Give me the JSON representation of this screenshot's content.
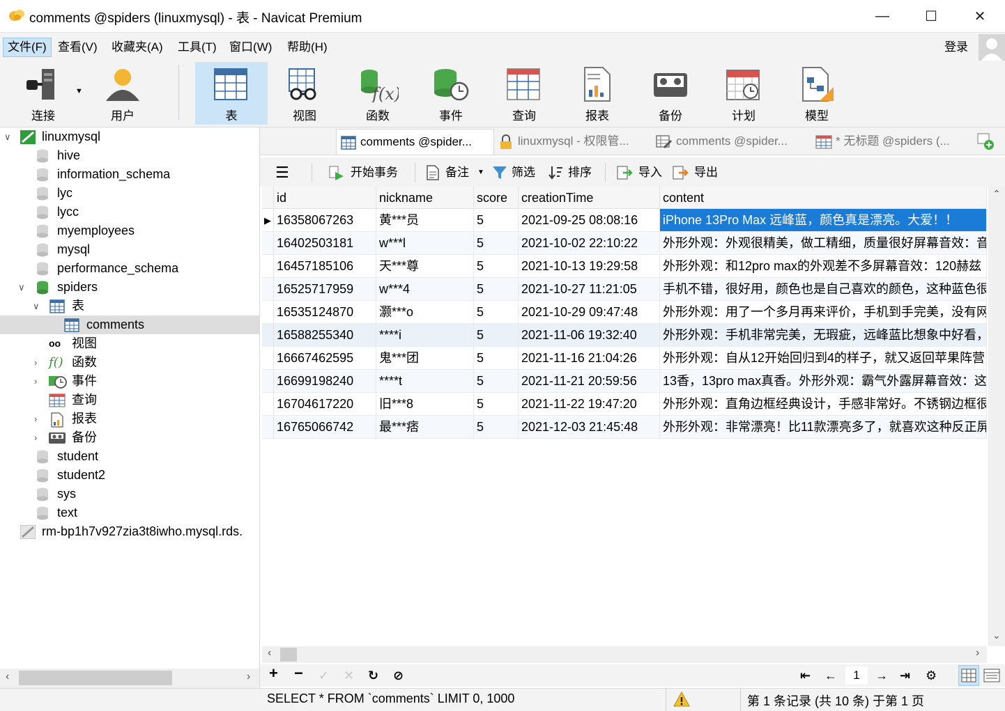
{
  "window": {
    "title": "comments @spiders (linuxmysql) - 表 - Navicat Premium",
    "minimize": "—",
    "maximize": "☐",
    "close": "✕"
  },
  "menu": {
    "items": [
      "文件(F)",
      "查看(V)",
      "收藏夹(A)",
      "工具(T)",
      "窗口(W)",
      "帮助(H)"
    ],
    "login": "登录"
  },
  "toolbar": {
    "connect": "连接",
    "user": "用户",
    "table": "表",
    "view": "视图",
    "function": "函数",
    "event": "事件",
    "query": "查询",
    "report": "报表",
    "backup": "备份",
    "schedule": "计划",
    "model": "模型"
  },
  "tree": {
    "connection": "linuxmysql",
    "databases_before": [
      "hive",
      "information_schema",
      "lyc",
      "lycc",
      "myemployees",
      "mysql",
      "performance_schema"
    ],
    "spiders": "spiders",
    "tables_node": "表",
    "selected_table": "comments",
    "views_node": "视图",
    "functions_node": "函数",
    "events_node": "事件",
    "queries_node": "查询",
    "reports_node": "报表",
    "backups_node": "备份",
    "databases_after": [
      "student",
      "student2",
      "sys",
      "text"
    ],
    "second_connection": "rm-bp1h7v927zia3t8iwho.mysql.rds."
  },
  "tabs": [
    "comments @spider...",
    "linuxmysql - 权限管...",
    "comments @spider...",
    "* 无标题 @spiders (..."
  ],
  "subtoolbar": {
    "begin_transaction": "开始事务",
    "memo": "备注",
    "filter": "筛选",
    "sort": "排序",
    "import": "导入",
    "export": "导出"
  },
  "grid": {
    "columns": [
      "id",
      "nickname",
      "score",
      "creationTime",
      "content"
    ],
    "rows": [
      [
        "16358067263",
        "黄***员",
        "5",
        "2021-09-25 08:08:16",
        "iPhone 13Pro Max 远峰蓝，颜色真是漂亮。大爱！！"
      ],
      [
        "16402503181",
        "w***l",
        "5",
        "2021-10-02 22:10:22",
        "外形外观：外观很精美，做工精细，质量很好屏幕音效：音"
      ],
      [
        "16457185106",
        "天***尊",
        "5",
        "2021-10-13 19:29:58",
        "外形外观：和12pro max的外观差不多屏幕音效：120赫兹"
      ],
      [
        "16525717959",
        "w***4",
        "5",
        "2021-10-27 11:21:05",
        "手机不错，很好用，颜色也是自己喜欢的颜色，这种蓝色很"
      ],
      [
        "16535124870",
        "灏***o",
        "5",
        "2021-10-29 09:47:48",
        "外形外观：用了一个多月再来评价，手机到手完美，没有网"
      ],
      [
        "16588255340",
        "****i",
        "5",
        "2021-11-06 19:32:40",
        "外形外观：手机非常完美，无瑕疵，远峰蓝比想象中好看，"
      ],
      [
        "16667462595",
        "鬼***团",
        "5",
        "2021-11-16 21:04:26",
        "外形外观：自从12开始回归到4的样子，就又返回苹果阵营"
      ],
      [
        "16699198240",
        "****t",
        "5",
        "2021-11-21 20:59:56",
        "13香，13pro max真香。外形外观：霸气外露屏幕音效：这"
      ],
      [
        "16704617220",
        "旧***8",
        "5",
        "2021-11-22 19:47:20",
        "外形外观：直角边框经典设计，手感非常好。不锈钢边框很"
      ],
      [
        "16765066742",
        "最***痞",
        "5",
        "2021-12-03 21:45:48",
        "外形外观：非常漂亮！比11款漂亮多了，就喜欢这种反正屏"
      ]
    ]
  },
  "nav": {
    "page": "1"
  },
  "status": {
    "sql": "SELECT * FROM `comments` LIMIT 0, 1000",
    "records": "第 1 条记录 (共 10 条) 于第 1 页"
  },
  "colors": {
    "selection": "#1a7cd6",
    "active_toolbar": "#cce4f7",
    "tree_selected": "#dddddd"
  }
}
